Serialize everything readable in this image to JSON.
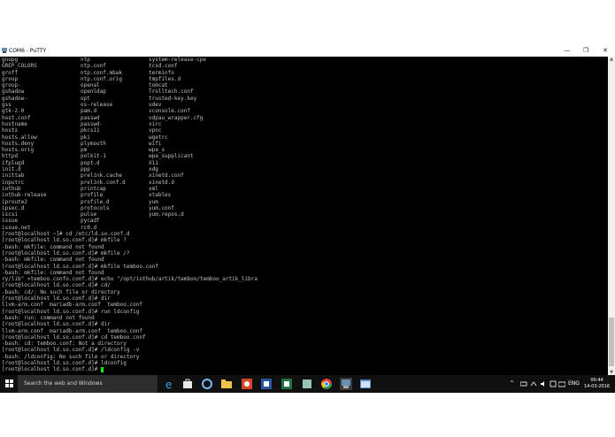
{
  "window": {
    "title": "COM6 - PuTTY",
    "buttons": {
      "minimize": "—",
      "maximize": "❐",
      "close": "✕"
    }
  },
  "terminal": {
    "columns": [
      [
        "gnupg",
        "GREP_COLORS",
        "groff",
        "group",
        "group-",
        "gshadow",
        "gshadow-",
        "gss",
        "gtk-2.0",
        "host.conf",
        "hostname",
        "hosts",
        "hosts.allow",
        "hosts.deny",
        "hosts.orig",
        "httpd",
        "ifplugd",
        "init.d",
        "inittab",
        "inputrc",
        "iothub",
        "iothub-release",
        "iproute2",
        "ipsec.d",
        "iscsi",
        "issue",
        "issue.net"
      ],
      [
        "ntp",
        "ntp.conf",
        "ntp.conf.mbak",
        "ntp.conf.orig",
        "openal",
        "openldap",
        "opt",
        "os-release",
        "pam.d",
        "passwd",
        "passwd-",
        "pkcs11",
        "pki",
        "plymouth",
        "pm",
        "polkit-1",
        "popt.d",
        "ppp",
        "prelink.cache",
        "prelink.conf.d",
        "printcap",
        "profile",
        "profile.d",
        "protocols",
        "pulse",
        "pycadf",
        "rc0.d"
      ],
      [
        "system-release-cpe",
        "tcsd.conf",
        "terminfo",
        "tmpfiles.d",
        "tomcat",
        "Trolltech.conf",
        "trusted-key.key",
        "udev",
        "vconsole.conf",
        "vdpau_wrapper.cfg",
        "virc",
        "vpnc",
        "wgetrc",
        "wifi",
        "wpa_s",
        "wpa_supplicant",
        "X11",
        "xdg",
        "xinetd.conf",
        "xinetd.d",
        "xml",
        "xtables",
        "yum",
        "yum.conf",
        "yum.repos.d"
      ]
    ],
    "tail_lines": [
      "[root@localhost ~]# cd /etc/ld.so.conf.d",
      "[root@localhost ld.so.conf.d]# mkfile ?",
      "-bash: mkfile: command not found",
      "[root@localhost ld.so.conf.d]# mkfile /?",
      "-bash: mkfile: command not found",
      "[root@localhost ld.so.conf.d]# mkfile temboo.conf",
      "-bash: mkfile: command not found",
      "ry/lib\" >temboo.confo.conf.d]# echo \"/opt/iothub/artik/temboo/temboo_artik_libra",
      "[root@localhost ld.so.conf.d]# cd/",
      "-bash: cd/: No such file or directory",
      "[root@localhost ld.so.conf.d]# dir",
      "llvm-arm.conf  mariadb-arm.conf  temboo.conf",
      "[root@localhost ld.so.conf.d]# run ldconfig",
      "-bash: run: command not found",
      "[root@localhost ld.so.conf.d]# dir",
      "llvm-arm.conf  mariadb-arm.conf  temboo.conf",
      "[root@localhost ld.so.conf.d]# cd temboo.conf",
      "-bash: cd: temboo.conf: Not a directory",
      "[root@localhost ld.so.conf.d]# /ldconfig -v",
      "-bash: /ldconfig: No such file or directory",
      "[root@localhost ld.so.conf.d]# ldconfig",
      "[root@localhost ld.so.conf.d]# "
    ],
    "colors": {
      "background": "#000000",
      "text": "#c0c0c0",
      "cursor": "#00ff00"
    }
  },
  "scrollbar": {
    "up": "▲",
    "down": "▼",
    "position_fraction": 0.85
  },
  "taskbar": {
    "search_placeholder": "Search the web and Windows",
    "apps": [
      "edge-icon",
      "store-icon",
      "cortana-icon",
      "file-explorer-icon",
      "powerpoint-icon",
      "word-icon",
      "excel-icon",
      "app-icon",
      "chrome-icon",
      "putty-icon",
      "window-icon"
    ],
    "tray": {
      "chevron": "^",
      "language": "ENG"
    },
    "clock": {
      "time": "00:44",
      "date": "14-03-2016"
    }
  }
}
